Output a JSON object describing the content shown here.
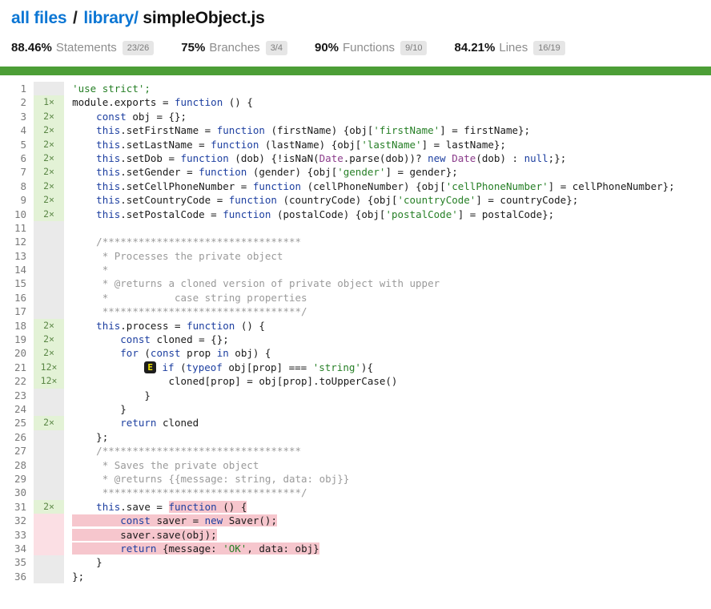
{
  "breadcrumb": {
    "parts": [
      {
        "text": "all files",
        "type": "link"
      },
      {
        "text": "/",
        "type": "sep"
      },
      {
        "text": "library/",
        "type": "link"
      },
      {
        "text": "simpleObject.js",
        "type": "current"
      }
    ]
  },
  "stats": [
    {
      "pct": "88.46%",
      "label": "Statements",
      "fraction": "23/26"
    },
    {
      "pct": "75%",
      "label": "Branches",
      "fraction": "3/4"
    },
    {
      "pct": "90%",
      "label": "Functions",
      "fraction": "9/10"
    },
    {
      "pct": "84.21%",
      "label": "Lines",
      "fraction": "16/19"
    }
  ],
  "colors": {
    "link": "#0b76d4",
    "bar": "#4c9e36",
    "covered_bg": "#e3f2d6",
    "uncovered_bg": "#fbdfe4",
    "uncovered_code_bg": "#f6c6cd",
    "blank_bg": "#eaeaea",
    "branch_marker_bg": "#1d1d1d",
    "branch_marker_fg": "#f2e400"
  },
  "code": {
    "first_line": 1,
    "last_line": 36,
    "lines": [
      {
        "n": 1,
        "count": "",
        "state": "blank"
      },
      {
        "n": 2,
        "count": "1×",
        "state": "covered"
      },
      {
        "n": 3,
        "count": "2×",
        "state": "covered"
      },
      {
        "n": 4,
        "count": "2×",
        "state": "covered"
      },
      {
        "n": 5,
        "count": "2×",
        "state": "covered"
      },
      {
        "n": 6,
        "count": "2×",
        "state": "covered"
      },
      {
        "n": 7,
        "count": "2×",
        "state": "covered"
      },
      {
        "n": 8,
        "count": "2×",
        "state": "covered"
      },
      {
        "n": 9,
        "count": "2×",
        "state": "covered"
      },
      {
        "n": 10,
        "count": "2×",
        "state": "covered"
      },
      {
        "n": 11,
        "count": "",
        "state": "blank"
      },
      {
        "n": 12,
        "count": "",
        "state": "blank"
      },
      {
        "n": 13,
        "count": "",
        "state": "blank"
      },
      {
        "n": 14,
        "count": "",
        "state": "blank"
      },
      {
        "n": 15,
        "count": "",
        "state": "blank"
      },
      {
        "n": 16,
        "count": "",
        "state": "blank"
      },
      {
        "n": 17,
        "count": "",
        "state": "blank"
      },
      {
        "n": 18,
        "count": "2×",
        "state": "covered"
      },
      {
        "n": 19,
        "count": "2×",
        "state": "covered"
      },
      {
        "n": 20,
        "count": "2×",
        "state": "covered"
      },
      {
        "n": 21,
        "count": "12×",
        "state": "covered"
      },
      {
        "n": 22,
        "count": "12×",
        "state": "covered"
      },
      {
        "n": 23,
        "count": "",
        "state": "blank"
      },
      {
        "n": 24,
        "count": "",
        "state": "blank"
      },
      {
        "n": 25,
        "count": "2×",
        "state": "covered"
      },
      {
        "n": 26,
        "count": "",
        "state": "blank"
      },
      {
        "n": 27,
        "count": "",
        "state": "blank"
      },
      {
        "n": 28,
        "count": "",
        "state": "blank"
      },
      {
        "n": 29,
        "count": "",
        "state": "blank"
      },
      {
        "n": 30,
        "count": "",
        "state": "blank"
      },
      {
        "n": 31,
        "count": "2×",
        "state": "covered"
      },
      {
        "n": 32,
        "count": "",
        "state": "uncov"
      },
      {
        "n": 33,
        "count": "",
        "state": "uncov"
      },
      {
        "n": 34,
        "count": "",
        "state": "uncov"
      },
      {
        "n": 35,
        "count": "",
        "state": "blank"
      },
      {
        "n": 36,
        "count": "",
        "state": "blank"
      }
    ],
    "source": [
      {
        "n": 1,
        "tokens": [
          {
            "t": "'use strict';",
            "c": "t-str"
          }
        ]
      },
      {
        "n": 2,
        "tokens": [
          {
            "t": "module",
            "c": "t-plain"
          },
          {
            "t": ".exports = ",
            "c": "t-plain"
          },
          {
            "t": "function",
            "c": "t-kw"
          },
          {
            "t": " () {",
            "c": "t-plain"
          }
        ]
      },
      {
        "n": 3,
        "tokens": [
          {
            "t": "    ",
            "c": "t-plain"
          },
          {
            "t": "const",
            "c": "t-kw"
          },
          {
            "t": " obj = {};",
            "c": "t-plain"
          }
        ]
      },
      {
        "n": 4,
        "tokens": [
          {
            "t": "    ",
            "c": "t-plain"
          },
          {
            "t": "this",
            "c": "t-kw"
          },
          {
            "t": ".setFirstName = ",
            "c": "t-plain"
          },
          {
            "t": "function",
            "c": "t-kw"
          },
          {
            "t": " (firstName) {obj[",
            "c": "t-plain"
          },
          {
            "t": "'firstName'",
            "c": "t-str"
          },
          {
            "t": "] = firstName};",
            "c": "t-plain"
          }
        ]
      },
      {
        "n": 5,
        "tokens": [
          {
            "t": "    ",
            "c": "t-plain"
          },
          {
            "t": "this",
            "c": "t-kw"
          },
          {
            "t": ".setLastName = ",
            "c": "t-plain"
          },
          {
            "t": "function",
            "c": "t-kw"
          },
          {
            "t": " (lastName) {obj[",
            "c": "t-plain"
          },
          {
            "t": "'lastName'",
            "c": "t-str"
          },
          {
            "t": "] = lastName};",
            "c": "t-plain"
          }
        ]
      },
      {
        "n": 6,
        "tokens": [
          {
            "t": "    ",
            "c": "t-plain"
          },
          {
            "t": "this",
            "c": "t-kw"
          },
          {
            "t": ".setDob = ",
            "c": "t-plain"
          },
          {
            "t": "function",
            "c": "t-kw"
          },
          {
            "t": " (dob) {!isNaN(",
            "c": "t-plain"
          },
          {
            "t": "Date",
            "c": "t-type"
          },
          {
            "t": ".parse(dob))? ",
            "c": "t-plain"
          },
          {
            "t": "new",
            "c": "t-kw"
          },
          {
            "t": " ",
            "c": "t-plain"
          },
          {
            "t": "Date",
            "c": "t-type"
          },
          {
            "t": "(dob) : ",
            "c": "t-plain"
          },
          {
            "t": "null",
            "c": "t-kw"
          },
          {
            "t": ";};",
            "c": "t-plain"
          }
        ]
      },
      {
        "n": 7,
        "tokens": [
          {
            "t": "    ",
            "c": "t-plain"
          },
          {
            "t": "this",
            "c": "t-kw"
          },
          {
            "t": ".setGender = ",
            "c": "t-plain"
          },
          {
            "t": "function",
            "c": "t-kw"
          },
          {
            "t": " (gender) {obj[",
            "c": "t-plain"
          },
          {
            "t": "'gender'",
            "c": "t-str"
          },
          {
            "t": "] = gender};",
            "c": "t-plain"
          }
        ]
      },
      {
        "n": 8,
        "tokens": [
          {
            "t": "    ",
            "c": "t-plain"
          },
          {
            "t": "this",
            "c": "t-kw"
          },
          {
            "t": ".setCellPhoneNumber = ",
            "c": "t-plain"
          },
          {
            "t": "function",
            "c": "t-kw"
          },
          {
            "t": " (cellPhoneNumber) {obj[",
            "c": "t-plain"
          },
          {
            "t": "'cellPhoneNumber'",
            "c": "t-str"
          },
          {
            "t": "] = cellPhoneNumber};",
            "c": "t-plain"
          }
        ]
      },
      {
        "n": 9,
        "tokens": [
          {
            "t": "    ",
            "c": "t-plain"
          },
          {
            "t": "this",
            "c": "t-kw"
          },
          {
            "t": ".setCountryCode = ",
            "c": "t-plain"
          },
          {
            "t": "function",
            "c": "t-kw"
          },
          {
            "t": " (countryCode) {obj[",
            "c": "t-plain"
          },
          {
            "t": "'countryCode'",
            "c": "t-str"
          },
          {
            "t": "] = countryCode};",
            "c": "t-plain"
          }
        ]
      },
      {
        "n": 10,
        "tokens": [
          {
            "t": "    ",
            "c": "t-plain"
          },
          {
            "t": "this",
            "c": "t-kw"
          },
          {
            "t": ".setPostalCode = ",
            "c": "t-plain"
          },
          {
            "t": "function",
            "c": "t-kw"
          },
          {
            "t": " (postalCode) {obj[",
            "c": "t-plain"
          },
          {
            "t": "'postalCode'",
            "c": "t-str"
          },
          {
            "t": "] = postalCode};",
            "c": "t-plain"
          }
        ]
      },
      {
        "n": 11,
        "tokens": [
          {
            "t": "",
            "c": "t-plain"
          }
        ]
      },
      {
        "n": 12,
        "tokens": [
          {
            "t": "    /*********************************",
            "c": "t-com"
          }
        ]
      },
      {
        "n": 13,
        "tokens": [
          {
            "t": "     * Processes the private object",
            "c": "t-com"
          }
        ]
      },
      {
        "n": 14,
        "tokens": [
          {
            "t": "     *",
            "c": "t-com"
          }
        ]
      },
      {
        "n": 15,
        "tokens": [
          {
            "t": "     * @returns a cloned version of private object with upper",
            "c": "t-com"
          }
        ]
      },
      {
        "n": 16,
        "tokens": [
          {
            "t": "     *           case string properties",
            "c": "t-com"
          }
        ]
      },
      {
        "n": 17,
        "tokens": [
          {
            "t": "     *********************************/",
            "c": "t-com"
          }
        ]
      },
      {
        "n": 18,
        "tokens": [
          {
            "t": "    ",
            "c": "t-plain"
          },
          {
            "t": "this",
            "c": "t-kw"
          },
          {
            "t": ".process = ",
            "c": "t-plain"
          },
          {
            "t": "function",
            "c": "t-kw"
          },
          {
            "t": " () {",
            "c": "t-plain"
          }
        ]
      },
      {
        "n": 19,
        "tokens": [
          {
            "t": "        ",
            "c": "t-plain"
          },
          {
            "t": "const",
            "c": "t-kw"
          },
          {
            "t": " cloned = {};",
            "c": "t-plain"
          }
        ]
      },
      {
        "n": 20,
        "tokens": [
          {
            "t": "        ",
            "c": "t-plain"
          },
          {
            "t": "for",
            "c": "t-kw"
          },
          {
            "t": " (",
            "c": "t-plain"
          },
          {
            "t": "const",
            "c": "t-kw"
          },
          {
            "t": " prop ",
            "c": "t-plain"
          },
          {
            "t": "in",
            "c": "t-kw"
          },
          {
            "t": " obj) {",
            "c": "t-plain"
          }
        ]
      },
      {
        "n": 21,
        "marker": "E",
        "marker_indent": 12,
        "tokens": [
          {
            "t": " ",
            "c": "t-plain"
          },
          {
            "t": "if",
            "c": "t-kw"
          },
          {
            "t": " (",
            "c": "t-plain"
          },
          {
            "t": "typeof",
            "c": "t-kw"
          },
          {
            "t": " obj[prop] === ",
            "c": "t-plain"
          },
          {
            "t": "'string'",
            "c": "t-str"
          },
          {
            "t": "){",
            "c": "t-plain"
          }
        ]
      },
      {
        "n": 22,
        "tokens": [
          {
            "t": "                cloned[prop] = obj[prop].toUpperCase()",
            "c": "t-plain"
          }
        ]
      },
      {
        "n": 23,
        "tokens": [
          {
            "t": "            }",
            "c": "t-plain"
          }
        ]
      },
      {
        "n": 24,
        "tokens": [
          {
            "t": "        }",
            "c": "t-plain"
          }
        ]
      },
      {
        "n": 25,
        "tokens": [
          {
            "t": "        ",
            "c": "t-plain"
          },
          {
            "t": "return",
            "c": "t-kw"
          },
          {
            "t": " cloned",
            "c": "t-plain"
          }
        ]
      },
      {
        "n": 26,
        "tokens": [
          {
            "t": "    };",
            "c": "t-plain"
          }
        ]
      },
      {
        "n": 27,
        "tokens": [
          {
            "t": "    /*********************************",
            "c": "t-com"
          }
        ]
      },
      {
        "n": 28,
        "tokens": [
          {
            "t": "     * Saves the private object",
            "c": "t-com"
          }
        ]
      },
      {
        "n": 29,
        "tokens": [
          {
            "t": "     * @returns {{message: string, data: obj}}",
            "c": "t-com"
          }
        ]
      },
      {
        "n": 30,
        "tokens": [
          {
            "t": "     *********************************/",
            "c": "t-com"
          }
        ]
      },
      {
        "n": 31,
        "tokens": [
          {
            "t": "    ",
            "c": "t-plain"
          },
          {
            "t": "this",
            "c": "t-kw"
          },
          {
            "t": ".save = ",
            "c": "t-plain"
          },
          {
            "t": "function",
            "c": "t-kw",
            "hl": true
          },
          {
            "t": " () {",
            "c": "t-plain",
            "hl": true
          }
        ]
      },
      {
        "n": 32,
        "tokens": [
          {
            "t": "        ",
            "c": "t-plain",
            "hl": true
          },
          {
            "t": "const",
            "c": "t-kw",
            "hl": true
          },
          {
            "t": " saver = ",
            "c": "t-plain",
            "hl": true
          },
          {
            "t": "new",
            "c": "t-kw",
            "hl": true
          },
          {
            "t": " Saver();",
            "c": "t-plain",
            "hl": true
          }
        ]
      },
      {
        "n": 33,
        "tokens": [
          {
            "t": "        saver.save(obj);",
            "c": "t-plain",
            "hl": true
          }
        ]
      },
      {
        "n": 34,
        "tokens": [
          {
            "t": "        ",
            "c": "t-plain",
            "hl": true
          },
          {
            "t": "return",
            "c": "t-kw",
            "hl": true
          },
          {
            "t": " {message: ",
            "c": "t-plain",
            "hl": true
          },
          {
            "t": "'OK'",
            "c": "t-str",
            "hl": true
          },
          {
            "t": ", data: obj}",
            "c": "t-plain",
            "hl": true
          }
        ]
      },
      {
        "n": 35,
        "tokens": [
          {
            "t": "    }",
            "c": "t-plain"
          }
        ]
      },
      {
        "n": 36,
        "tokens": [
          {
            "t": "};",
            "c": "t-plain"
          }
        ]
      }
    ]
  }
}
